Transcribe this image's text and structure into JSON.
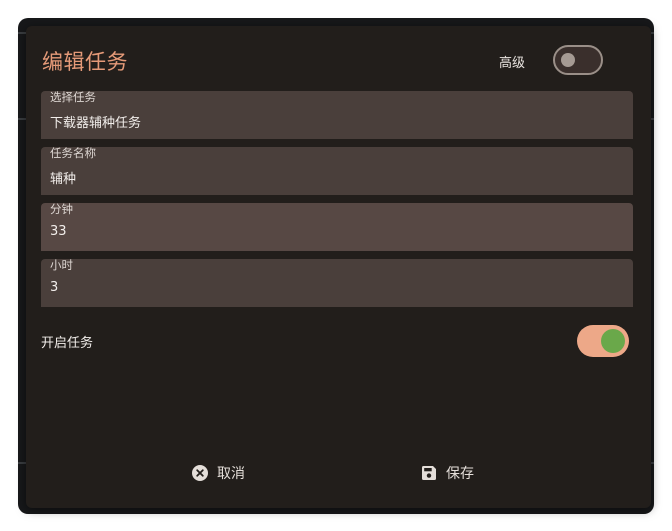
{
  "dialog": {
    "title": "编辑任务",
    "advanced_label": "高级",
    "advanced_on": false
  },
  "fields": [
    {
      "label": "选择任务",
      "value": "下载器辅种任务"
    },
    {
      "label": "任务名称",
      "value": "辅种"
    },
    {
      "label": "分钟",
      "value": "33"
    },
    {
      "label": "小时",
      "value": "3"
    }
  ],
  "enable": {
    "label": "开启任务",
    "on": true
  },
  "actions": {
    "cancel": "取消",
    "save": "保存"
  },
  "icons": {
    "cancel": "cancel-circle-icon",
    "save": "floppy-disk-icon"
  },
  "colors": {
    "accent": "#e59a78",
    "switch_track_on": "#eda888",
    "switch_knob_on": "#6aa84a",
    "dialog_bg": "#221e1b"
  }
}
